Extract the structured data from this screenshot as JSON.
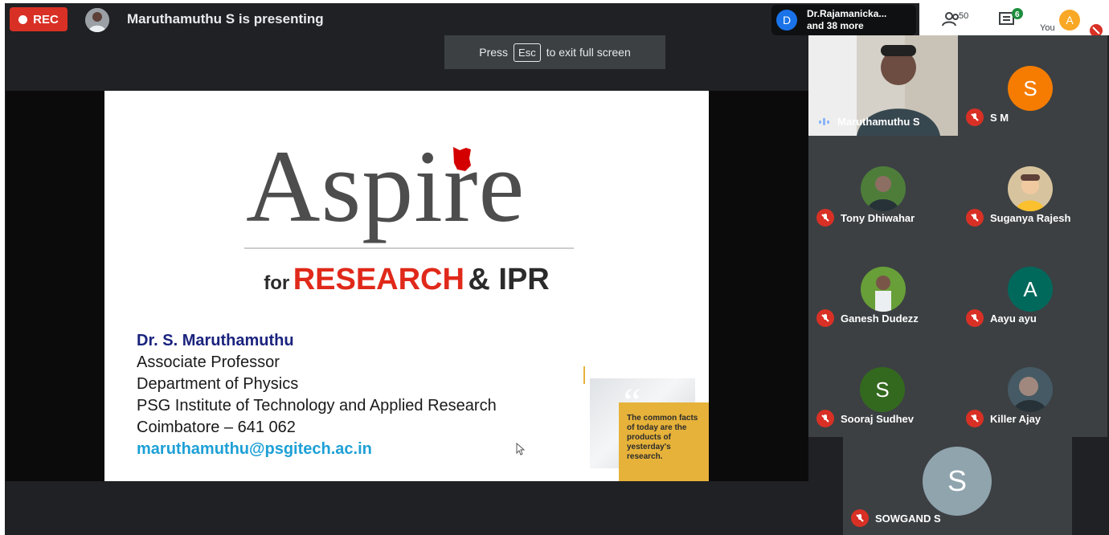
{
  "recording": {
    "label": "REC"
  },
  "presenter": {
    "presenting_text": "Maruthamuthu S is presenting"
  },
  "fullscreen_notice": {
    "press": "Press",
    "key": "Esc",
    "suffix": "to exit full screen"
  },
  "people_chip": {
    "initial": "D",
    "name": "Dr.Rajamanicka...",
    "more": "and 38 more"
  },
  "toolbar": {
    "participant_count": "50",
    "chat_badge": "6",
    "you_label": "You",
    "you_initial": "A"
  },
  "slide": {
    "title": "Aspire",
    "tagline_for": "for",
    "tagline_research": "RESEARCH",
    "tagline_ipr": "& IPR",
    "name": "Dr. S. Maruthamuthu",
    "role": "Associate Professor",
    "department": "Department of Physics",
    "institute": "PSG Institute of Technology and Applied Research",
    "city": "Coimbatore – 641 062",
    "email": "maruthamuthu@psgitech.ac.in",
    "quote_mark": "“",
    "quote": "The common facts of today are the products of yesterday's research."
  },
  "participants": [
    {
      "name": "Maruthamuthu S",
      "type": "video",
      "speaking": true
    },
    {
      "name": "S M",
      "initial": "S",
      "color": "#f57c00"
    },
    {
      "name": "Tony Dhiwahar",
      "type": "photo"
    },
    {
      "name": "Suganya Rajesh",
      "type": "photo"
    },
    {
      "name": "Ganesh Dudezz",
      "type": "photo"
    },
    {
      "name": "Aayu ayu",
      "initial": "A",
      "color": "#00695c"
    },
    {
      "name": "Sooraj Sudhev",
      "initial": "S",
      "color": "#33691e"
    },
    {
      "name": "Killer Ajay",
      "type": "photo"
    },
    {
      "name": "SOWGAND S",
      "initial": "S",
      "color": "#90a4ae"
    }
  ],
  "colors": {
    "accent_red": "#d93025",
    "research_red": "#e0291a",
    "email_blue": "#1ea0d6"
  }
}
